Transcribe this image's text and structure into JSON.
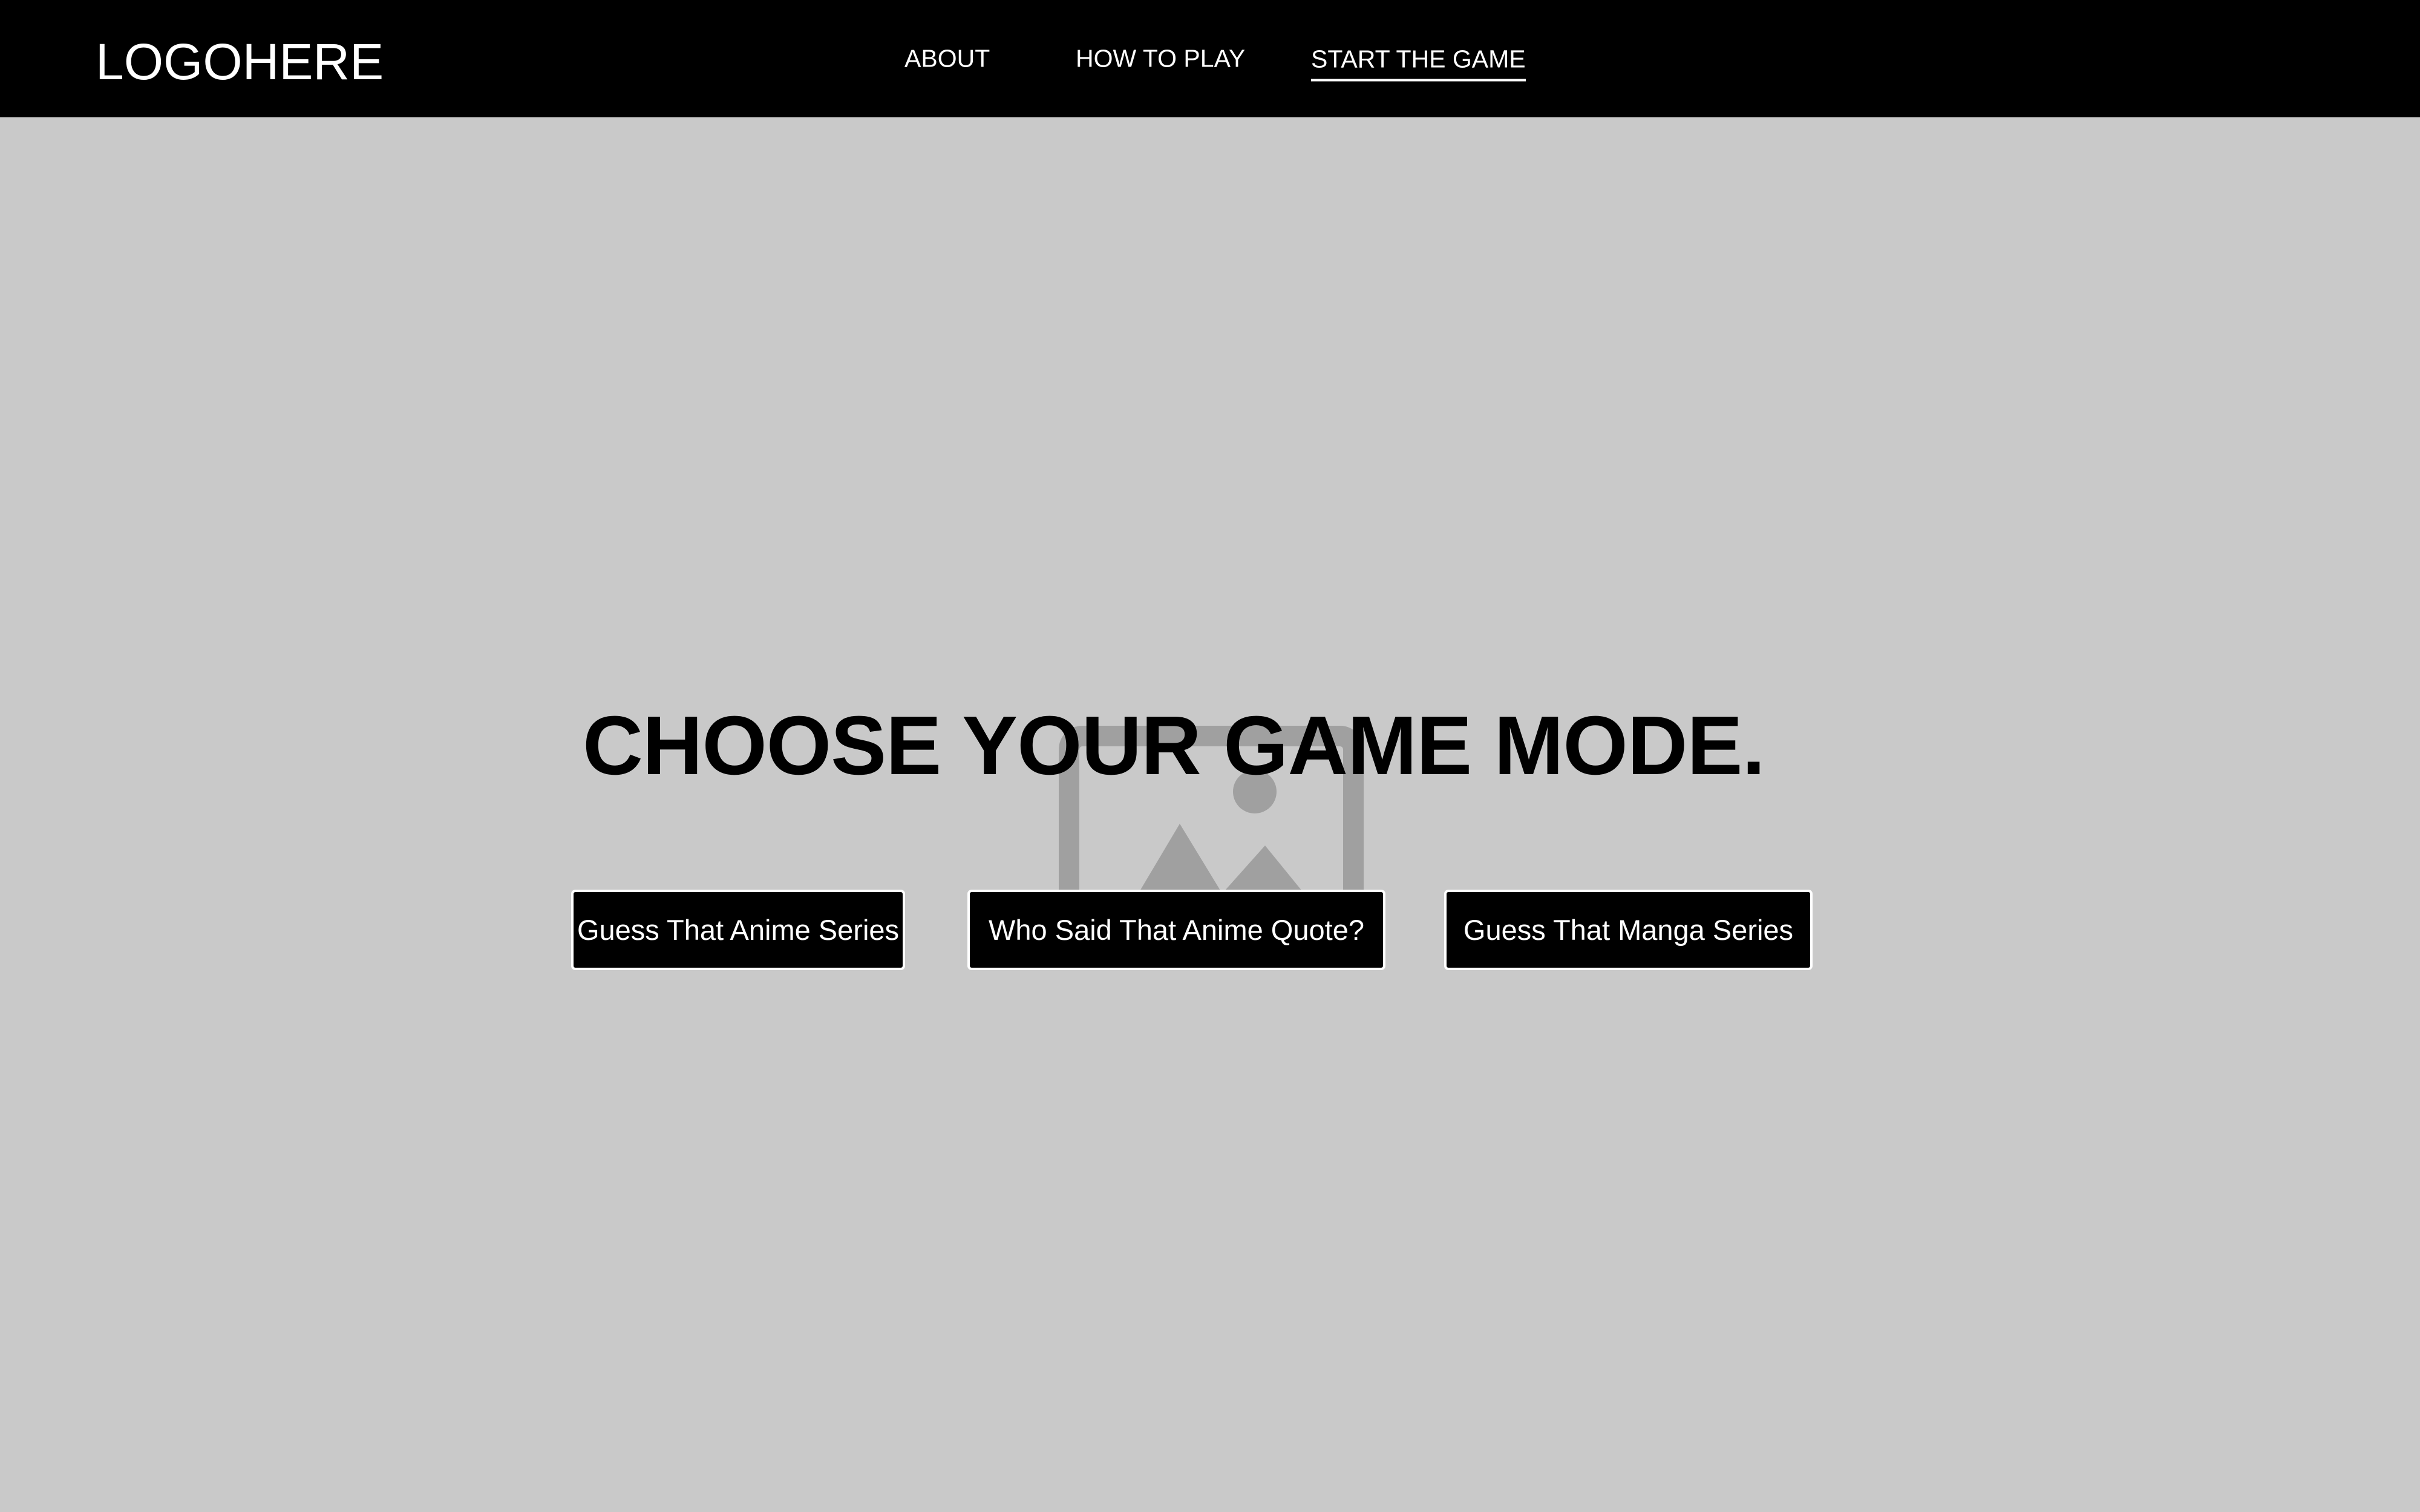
{
  "header": {
    "logo_text": "LOGOHERE",
    "nav": {
      "about": "ABOUT",
      "how_to_play": "HOW TO PLAY",
      "start_game": "START THE GAME"
    },
    "active_nav": "start_game"
  },
  "main": {
    "heading": "CHOOSE YOUR GAME MODE.",
    "background_icon": "image-placeholder-icon",
    "modes": {
      "anime_series": "Guess That Anime Series",
      "anime_quote": "Who Said That Anime Quote?",
      "manga_series": "Guess That Manga Series"
    }
  },
  "colors": {
    "header_background": "#000000",
    "page_background": "#c9c9c9",
    "button_background": "#000000",
    "button_text": "#ffffff",
    "button_border": "#ffffff",
    "placeholder_icon": "#a0a0a0"
  }
}
